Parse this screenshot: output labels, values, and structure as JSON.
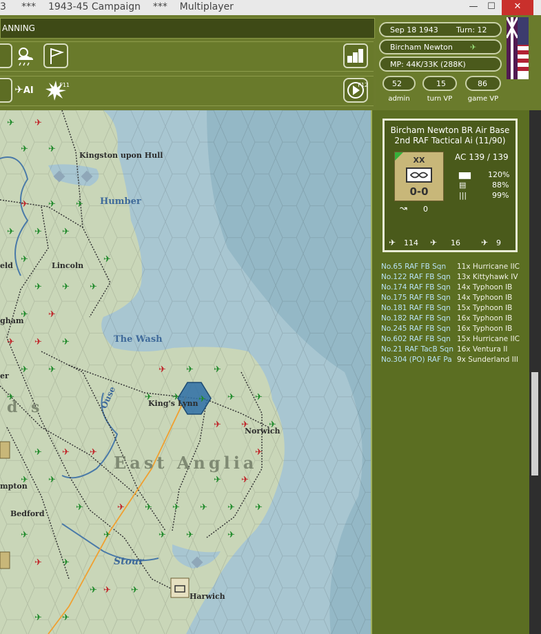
{
  "window": {
    "title": "3     ***    1943-45 Campaign    ***    Multiplayer",
    "close_glyph": "✕",
    "max_glyph": "☐",
    "min_glyph": "—"
  },
  "topbar": {
    "phase_label": "ANNING",
    "f11": "F11",
    "f12": "F12",
    "ai_label": "AI"
  },
  "info": {
    "date": "Sep 18 1943",
    "turn": "Turn: 12",
    "location": "Bircham Newton",
    "mp": "MP:  44K/33K (288K)",
    "vp": [
      {
        "value": "52",
        "label": "admin"
      },
      {
        "value": "15",
        "label": "turn VP"
      },
      {
        "value": "86",
        "label": "game VP"
      }
    ]
  },
  "unit": {
    "title_line1": "Bircham Newton BR Air Base",
    "title_line2": "2nd RAF Tactical Ai (11/90)",
    "size_marker": "XX",
    "counter_value": "0-0",
    "ac": "AC  139 / 139",
    "stats": [
      "120%",
      "88%",
      "99%"
    ],
    "supply": "0",
    "fighters": "114",
    "bombers": "16",
    "transports": "9"
  },
  "squadrons": [
    {
      "name": "No.65 RAF FB Sqn",
      "aircraft": "11x Hurricane IIC"
    },
    {
      "name": "No.122 RAF FB Sqn",
      "aircraft": "13x Kittyhawk IV"
    },
    {
      "name": "No.174 RAF FB Sqn",
      "aircraft": "14x Typhoon IB"
    },
    {
      "name": "No.175 RAF FB Sqn",
      "aircraft": "14x Typhoon IB"
    },
    {
      "name": "No.181 RAF FB Sqn",
      "aircraft": "15x Typhoon IB"
    },
    {
      "name": "No.182 RAF FB Sqn",
      "aircraft": "16x Typhoon IB"
    },
    {
      "name": "No.245 RAF FB Sqn",
      "aircraft": "16x Typhoon IB"
    },
    {
      "name": "No.602 RAF FB Sqn",
      "aircraft": "15x Hurricane IIC"
    },
    {
      "name": "No.21 RAF TacB Sqn",
      "aircraft": "16x Ventura II"
    },
    {
      "name": "No.304 (PO) RAF Pa",
      "aircraft": "9x Sunderland III"
    }
  ],
  "map": {
    "labels": {
      "hull": "Kingston upon Hull",
      "humber": "Humber",
      "lincoln": "Lincoln",
      "eld": "eld",
      "gham": "gham",
      "wash": "The Wash",
      "er": "er",
      "ds": "d s",
      "ouse": "Ouse",
      "kings_lynn": "King's Lynn",
      "norwich": "Norwich",
      "east_anglia": "East Anglia",
      "mpton": "mpton",
      "bedford": "Bedford",
      "stour": "Stour",
      "harwich": "Harwich"
    }
  },
  "colors": {
    "land": "#c9d6b8",
    "sea": "#a8c6d1",
    "deep_sea": "#94b8c6",
    "panel": "#5b6e22",
    "allied_icon": "#1f8a2a",
    "axis_icon": "#c0262a",
    "selected_hex": "#2e6fa6"
  }
}
